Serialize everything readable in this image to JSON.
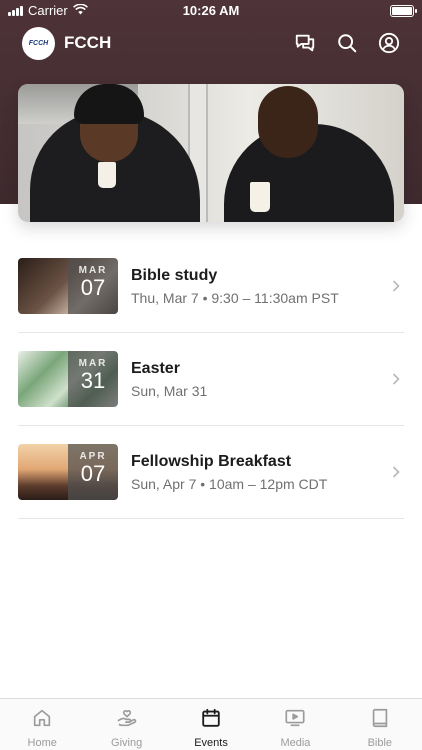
{
  "status_bar": {
    "carrier": "Carrier",
    "time": "10:26 AM"
  },
  "app": {
    "title": "FCCH",
    "logo_text": "FCCH"
  },
  "hero": {
    "image": "photo of two young men holding coffee cups"
  },
  "events": [
    {
      "month": "MAR",
      "day": "07",
      "title": "Bible study",
      "subtitle": "Thu, Mar 7 • 9:30 – 11:30am PST"
    },
    {
      "month": "MAR",
      "day": "31",
      "title": "Easter",
      "subtitle": "Sun, Mar 31"
    },
    {
      "month": "APR",
      "day": "07",
      "title": "Fellowship Breakfast",
      "subtitle": "Sun, Apr 7 • 10am – 12pm CDT"
    }
  ],
  "tabs": [
    {
      "label": "Home",
      "icon": "home-icon"
    },
    {
      "label": "Giving",
      "icon": "giving-icon"
    },
    {
      "label": "Events",
      "icon": "calendar-icon",
      "active": true
    },
    {
      "label": "Media",
      "icon": "media-icon"
    },
    {
      "label": "Bible",
      "icon": "book-icon"
    }
  ],
  "colors": {
    "header": "#4e3338",
    "active_tab": "#1c1c1c",
    "inactive_tab": "#9b9b9b"
  }
}
